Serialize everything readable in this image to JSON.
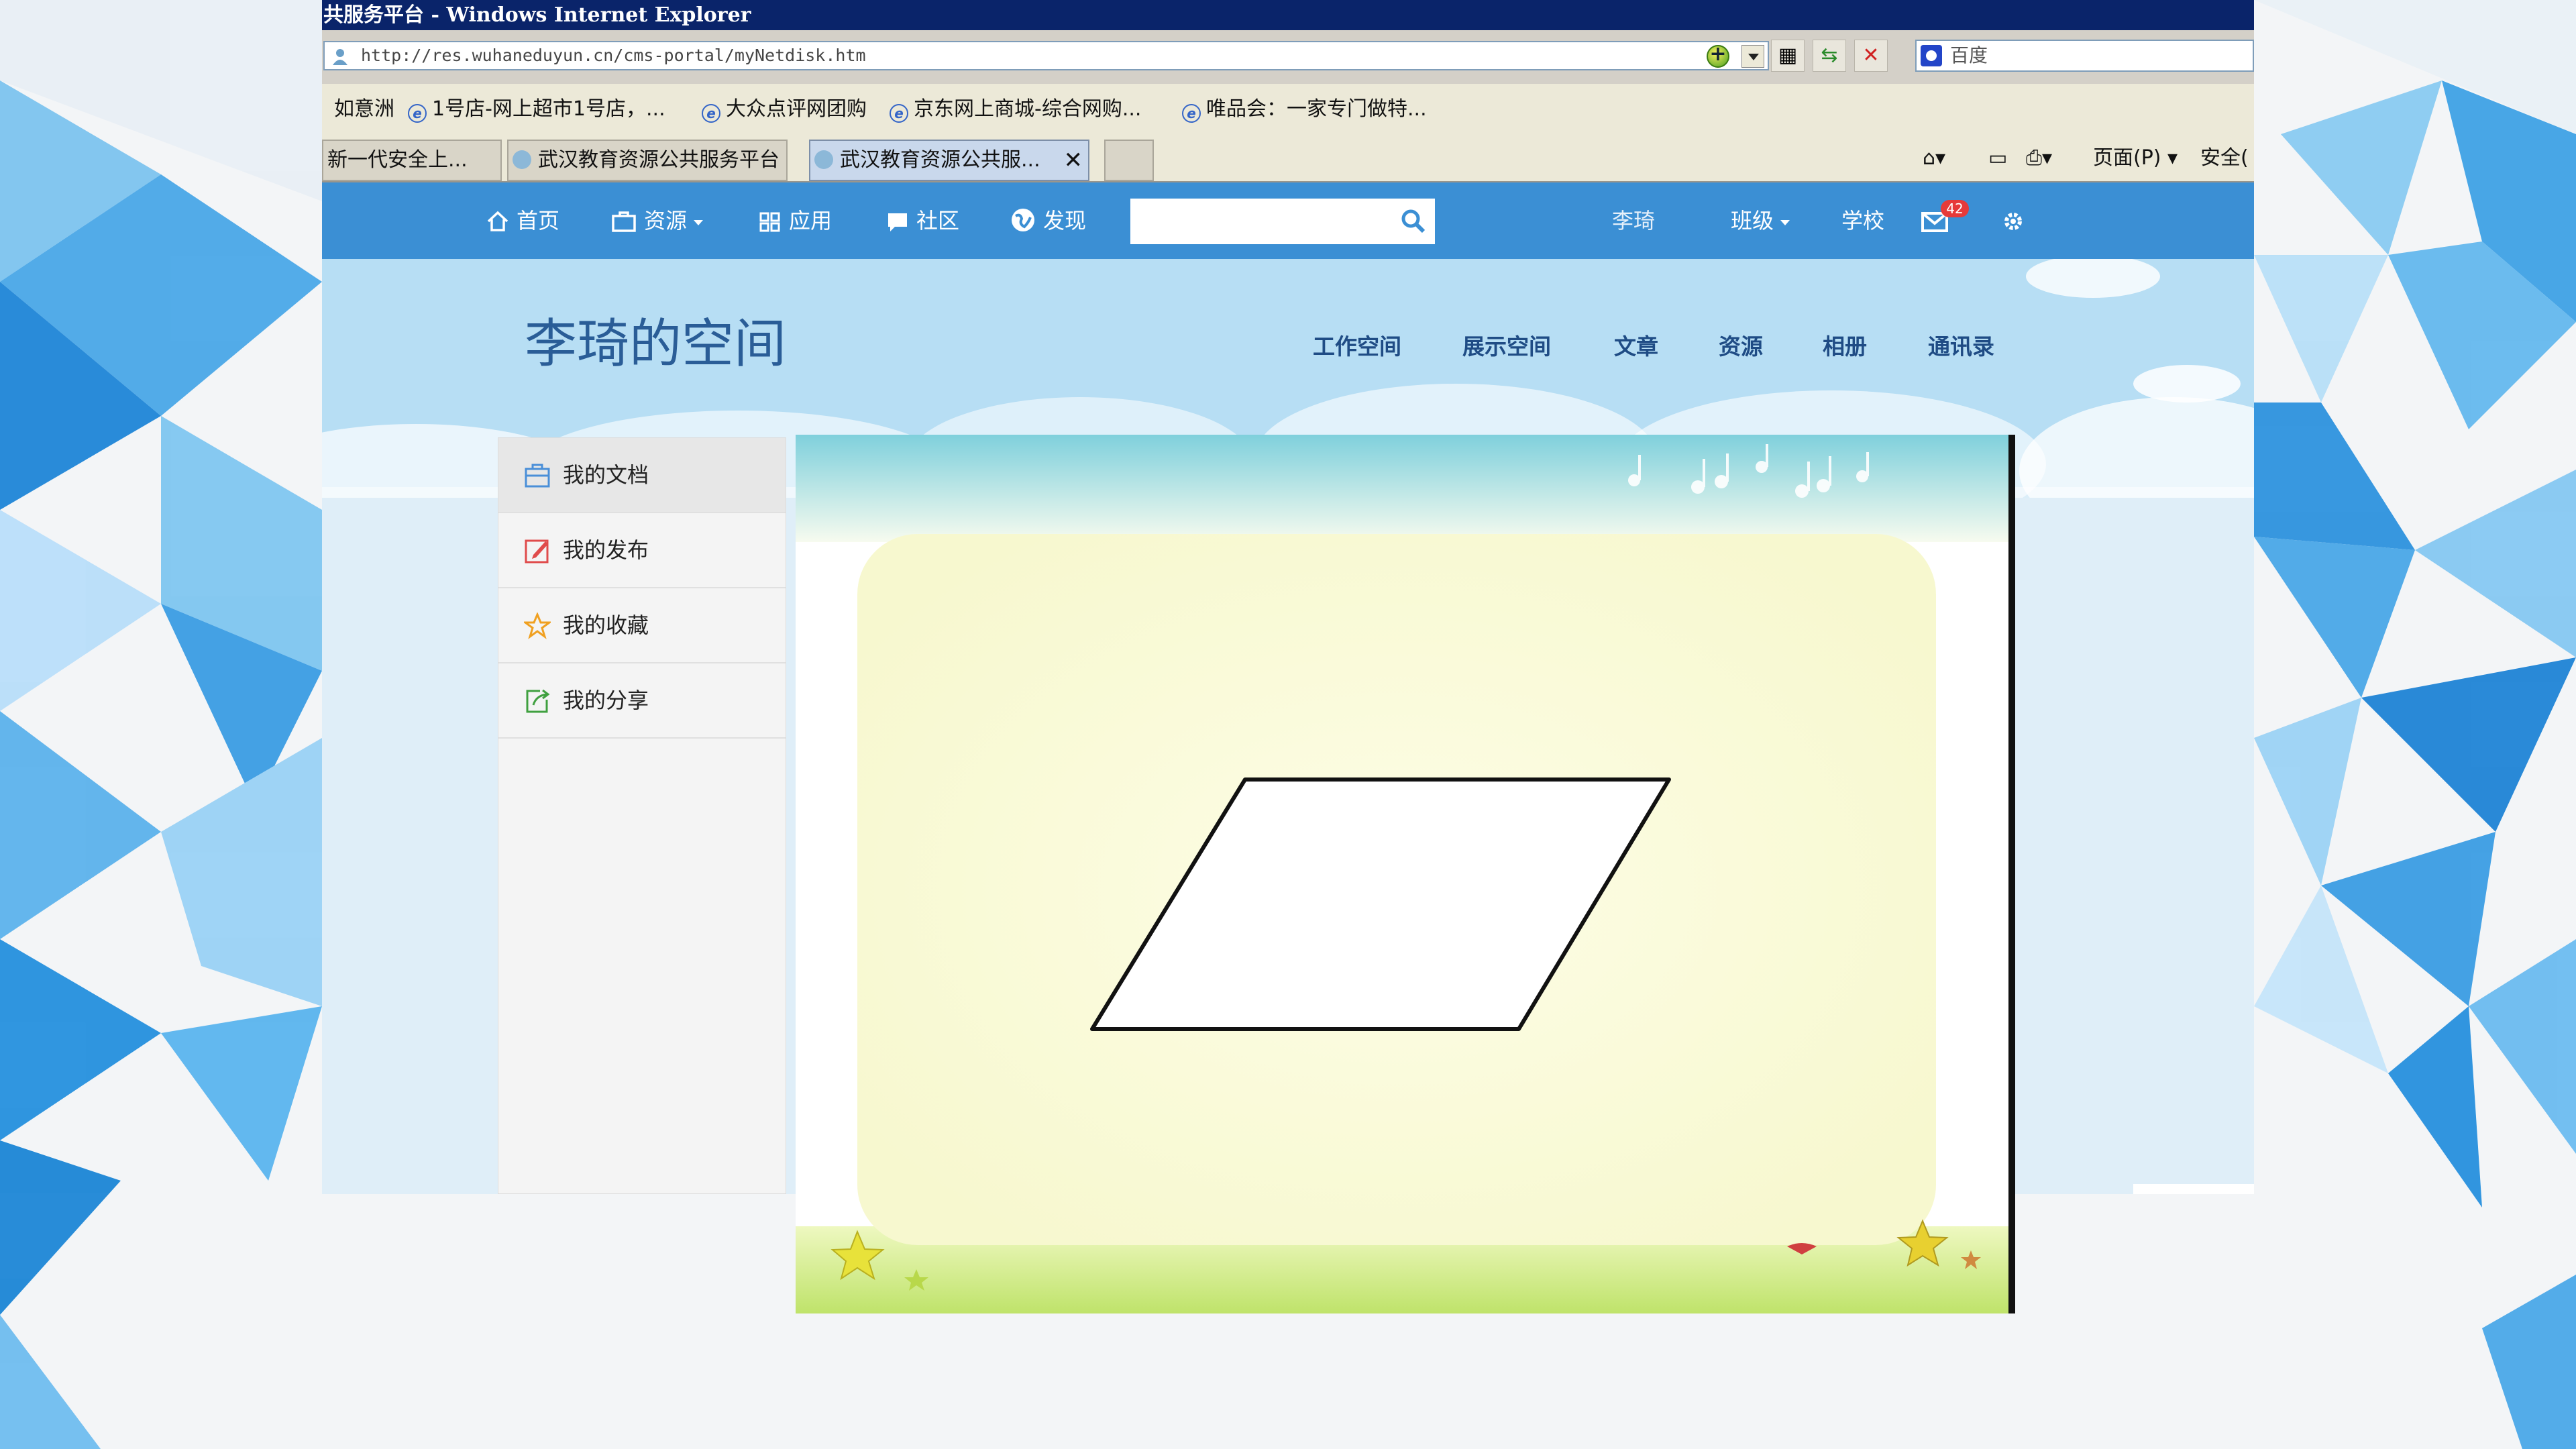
{
  "window": {
    "title": "共服务平台 - Windows Internet Explorer"
  },
  "address_bar": {
    "url": "http://res.wuhaneduyun.cn/cms-portal/myNetdisk.htm",
    "search_engine": "百度"
  },
  "favorites": [
    {
      "label": "如意洲"
    },
    {
      "label": "1号店-网上超市1号店，..."
    },
    {
      "label": "大众点评网团购"
    },
    {
      "label": "京东网上商城-综合网购..."
    },
    {
      "label": "唯品会：一家专门做特..."
    }
  ],
  "tabs": [
    {
      "label": "新一代安全上..."
    },
    {
      "label": "武汉教育资源公共服务平台"
    },
    {
      "label": "武汉教育资源公共服..."
    }
  ],
  "command_bar": {
    "page_label": "页面(P)",
    "safety_label": "安全("
  },
  "site_nav": {
    "home": "首页",
    "resources": "资源",
    "apps": "应用",
    "community": "社区",
    "discover": "发现",
    "search_value": "",
    "user": "李琦",
    "class": "班级",
    "school": "学校",
    "mail_count": "42"
  },
  "space": {
    "title": "李琦的空间",
    "tabs": [
      "工作空间",
      "展示空间",
      "文章",
      "资源",
      "相册",
      "通讯录"
    ]
  },
  "sidebar": {
    "items": [
      {
        "label": "我的文档",
        "icon": "briefcase-icon",
        "color": "#4a8fd8"
      },
      {
        "label": "我的发布",
        "icon": "edit-icon",
        "color": "#e04b4b"
      },
      {
        "label": "我的收藏",
        "icon": "star-icon",
        "color": "#f0a020"
      },
      {
        "label": "我的分享",
        "icon": "share-icon",
        "color": "#40a040"
      }
    ]
  },
  "colors": {
    "nav_bar": "#3b8fd4",
    "title_bar": "#0a246a",
    "space_title": "#2a5d97"
  }
}
